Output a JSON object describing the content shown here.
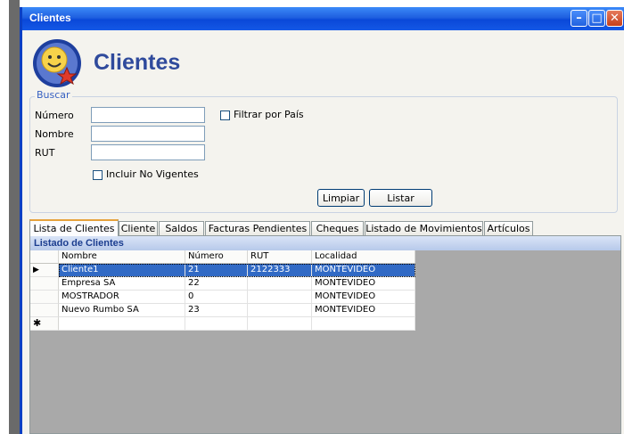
{
  "window": {
    "title": "Clientes"
  },
  "header": {
    "title": "Clientes"
  },
  "search": {
    "group_label": "Buscar",
    "numero_label": "Número",
    "nombre_label": "Nombre",
    "rut_label": "RUT",
    "numero_value": "",
    "nombre_value": "",
    "rut_value": "",
    "filtrar_pais_label": "Filtrar por País",
    "filtrar_pais_checked": false,
    "incluir_no_vigentes_label": "Incluir No Vigentes",
    "incluir_no_vigentes_checked": false,
    "limpiar_label": "Limpiar",
    "listar_label": "Listar"
  },
  "tabs": [
    {
      "label": "Lista de Clientes",
      "active": true
    },
    {
      "label": "Cliente"
    },
    {
      "label": "Saldos"
    },
    {
      "label": "Facturas Pendientes"
    },
    {
      "label": "Cheques"
    },
    {
      "label": "Listado de Movimientos"
    },
    {
      "label": "Artículos"
    }
  ],
  "list": {
    "caption": "Listado de Clientes",
    "columns": [
      "Nombre",
      "Número",
      "RUT",
      "Localidad"
    ],
    "rows": [
      [
        "Cliente1",
        "21",
        "2122333",
        "MONTEVIDEO"
      ],
      [
        "Empresa SA",
        "22",
        "",
        "MONTEVIDEO"
      ],
      [
        "MOSTRADOR",
        "0",
        "",
        "MONTEVIDEO"
      ],
      [
        "Nuevo Rumbo SA",
        "23",
        "",
        "MONTEVIDEO"
      ]
    ],
    "selected_row": 0,
    "current_row_marker": "▶",
    "new_row_marker": "✱"
  },
  "colors": {
    "titlebar": "#0a48d8",
    "accent_title": "#2f4a9c",
    "selection": "#316ac5",
    "group_label": "#3761c2"
  }
}
